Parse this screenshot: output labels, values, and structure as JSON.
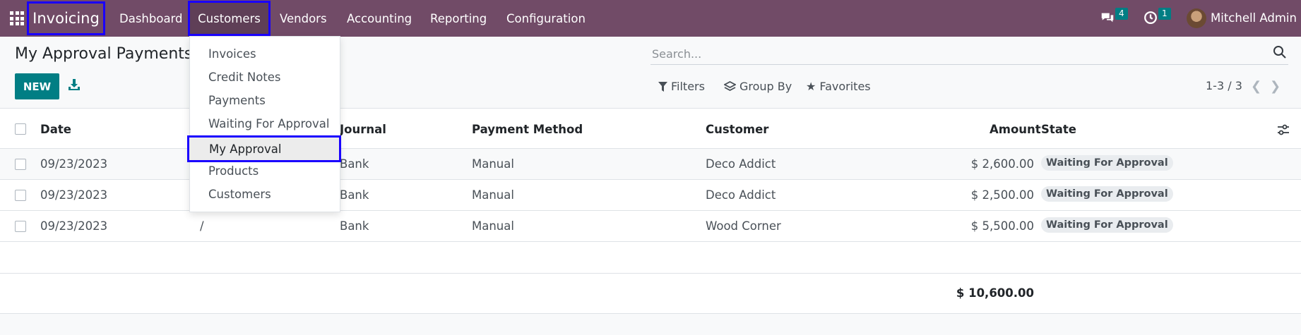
{
  "navbar": {
    "app_name": "Invoicing",
    "menu": [
      "Dashboard",
      "Customers",
      "Vendors",
      "Accounting",
      "Reporting",
      "Configuration"
    ],
    "messages_count": "4",
    "activities_count": "1",
    "user_name": "Mitchell Admin",
    "icons": [
      "apps-grid-icon",
      "chat-icon",
      "clock-icon",
      "avatar"
    ]
  },
  "control_panel": {
    "title": "My Approval Payments",
    "new_label": "NEW",
    "search_placeholder": "Search...",
    "filters_label": "Filters",
    "group_by_label": "Group By",
    "favorites_label": "Favorites",
    "pager": "1-3 / 3"
  },
  "dropdown": {
    "items": [
      "Invoices",
      "Credit Notes",
      "Payments",
      "Waiting For Approval",
      "My Approval",
      "Products",
      "Customers"
    ],
    "highlighted": "My Approval"
  },
  "table": {
    "columns": [
      "Date",
      "Journal",
      "Payment Method",
      "Customer",
      "Amount",
      "State"
    ],
    "rows": [
      {
        "date": "09/23/2023",
        "number": "",
        "journal": "Bank",
        "method": "Manual",
        "customer": "Deco Addict",
        "amount": "$ 2,600.00",
        "state": "Waiting For Approval"
      },
      {
        "date": "09/23/2023",
        "number": "",
        "journal": "Bank",
        "method": "Manual",
        "customer": "Deco Addict",
        "amount": "$ 2,500.00",
        "state": "Waiting For Approval"
      },
      {
        "date": "09/23/2023",
        "number": "/",
        "journal": "Bank",
        "method": "Manual",
        "customer": "Wood Corner",
        "amount": "$ 5,500.00",
        "state": "Waiting For Approval"
      }
    ],
    "total": "$ 10,600.00"
  },
  "colors": {
    "navbar": "#714b67",
    "primary": "#017e84",
    "highlight_border": "#1a00ff"
  }
}
